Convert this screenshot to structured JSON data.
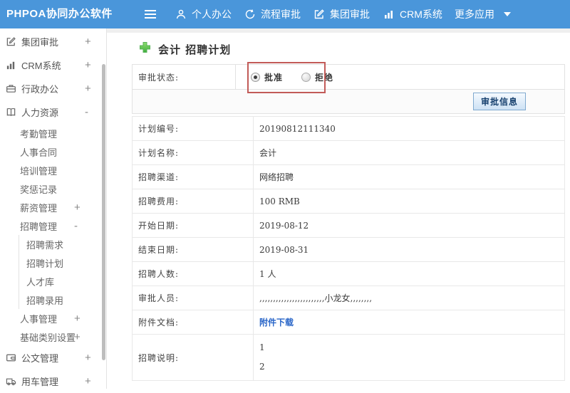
{
  "navbar": {
    "brand": "PHPOA协同办公软件",
    "items": [
      {
        "label": "个人办公",
        "icon": "user-icon"
      },
      {
        "label": "流程审批",
        "icon": "history-icon"
      },
      {
        "label": "集团审批",
        "icon": "edit-square-icon"
      },
      {
        "label": "CRM系统",
        "icon": "bar-chart-icon"
      },
      {
        "label": "更多应用",
        "icon": "caret-down-icon"
      }
    ]
  },
  "sidebar": {
    "items": [
      {
        "label": "集团审批",
        "icon": "edit-square-icon",
        "toggle": "+"
      },
      {
        "label": "CRM系统",
        "icon": "bar-chart-icon",
        "toggle": "+"
      },
      {
        "label": "行政办公",
        "icon": "briefcase-icon",
        "toggle": "+"
      },
      {
        "label": "人力资源",
        "icon": "book-icon",
        "toggle": "-"
      },
      {
        "label": "考勤管理"
      },
      {
        "label": "人事合同"
      },
      {
        "label": "培训管理"
      },
      {
        "label": "奖惩记录"
      },
      {
        "label": "薪资管理",
        "toggle": "+"
      },
      {
        "label": "招聘管理",
        "toggle": "-"
      },
      {
        "label": "招聘需求"
      },
      {
        "label": "招聘计划"
      },
      {
        "label": "人才库"
      },
      {
        "label": "招聘录用"
      },
      {
        "label": "人事管理",
        "toggle": "+"
      },
      {
        "label": "基础类别设置",
        "toggle": "+"
      },
      {
        "label": "公文管理",
        "icon": "wallet-icon",
        "toggle": "+"
      },
      {
        "label": "用车管理",
        "icon": "truck-icon",
        "toggle": "+"
      }
    ]
  },
  "main": {
    "title": "会计 招聘计划",
    "approval": {
      "label": "审批状态:",
      "approve_label": "批准",
      "reject_label": "拒绝",
      "selected": "批准",
      "info_button": "审批信息"
    },
    "fields": [
      {
        "label": "计划编号:",
        "value": "20190812111340"
      },
      {
        "label": "计划名称:",
        "value": "会计"
      },
      {
        "label": "招聘渠道:",
        "value": "网络招聘"
      },
      {
        "label": "招聘费用:",
        "value": "100 RMB"
      },
      {
        "label": "开始日期:",
        "value": "2019-08-12"
      },
      {
        "label": "结束日期:",
        "value": "2019-08-31"
      },
      {
        "label": "招聘人数:",
        "value": "1 人"
      },
      {
        "label": "审批人员:",
        "value": ",,,,,,,,,,,,,,,,,,,,,,,,小龙女,,,,,,,,"
      },
      {
        "label": "附件文档:",
        "value": "附件下载"
      },
      {
        "label": "招聘说明:",
        "lines": [
          "1",
          "2"
        ]
      }
    ]
  },
  "colors": {
    "navbar_blue": "#4a96da",
    "link_blue": "#2a66c8",
    "annotation_red": "#c25b58",
    "plus_green": "#4db14d"
  }
}
